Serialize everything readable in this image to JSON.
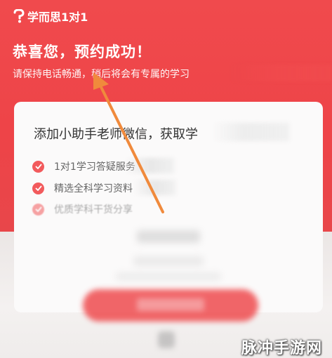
{
  "header": {
    "logo_text": "学而思1对1",
    "headline": "恭喜您，预约成功！",
    "subline": "请保持电话畅通，稍后将会有专属的学习"
  },
  "card": {
    "title": "添加小助手老师微信，获取学",
    "benefits": [
      {
        "label": "1对1学习答疑服务"
      },
      {
        "label": "精选全科学习资料"
      },
      {
        "label": "优质学科干货分享"
      }
    ]
  },
  "watermark": "脉冲手游网",
  "colors": {
    "brand_red": "#ee4448",
    "check_red": "#f25a5c",
    "arrow_orange": "#f08a3c"
  }
}
